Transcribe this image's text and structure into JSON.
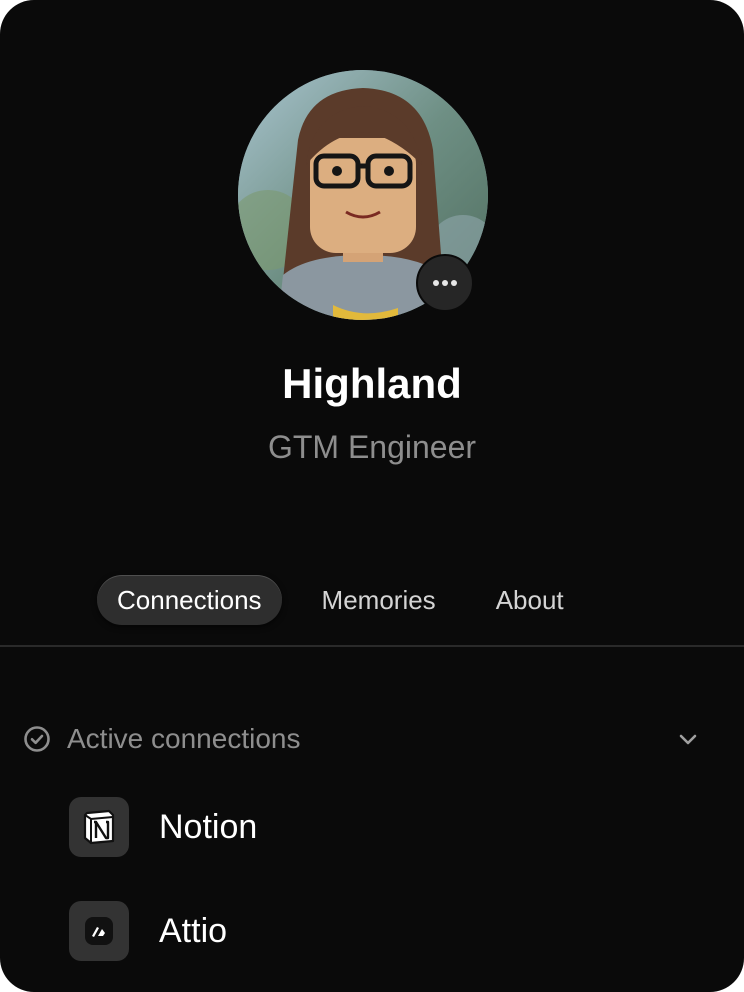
{
  "profile": {
    "name": "Highland",
    "role": "GTM Engineer",
    "avatar_icon": "avatar-portrait",
    "more_icon": "ellipsis-icon"
  },
  "tabs": [
    {
      "label": "Connections",
      "active": true
    },
    {
      "label": "Memories",
      "active": false
    },
    {
      "label": "About",
      "active": false
    }
  ],
  "section": {
    "title": "Active connections",
    "status_icon": "check-circle-icon",
    "toggle_icon": "chevron-down-icon"
  },
  "connections": [
    {
      "label": "Notion",
      "icon": "notion-icon"
    },
    {
      "label": "Attio",
      "icon": "attio-icon"
    }
  ],
  "colors": {
    "background": "#0a0a0a",
    "text_primary": "#ffffff",
    "text_secondary": "#8e8e8e",
    "tab_active_bg": "#2e2e2e",
    "icon_tile_bg": "#333333"
  }
}
